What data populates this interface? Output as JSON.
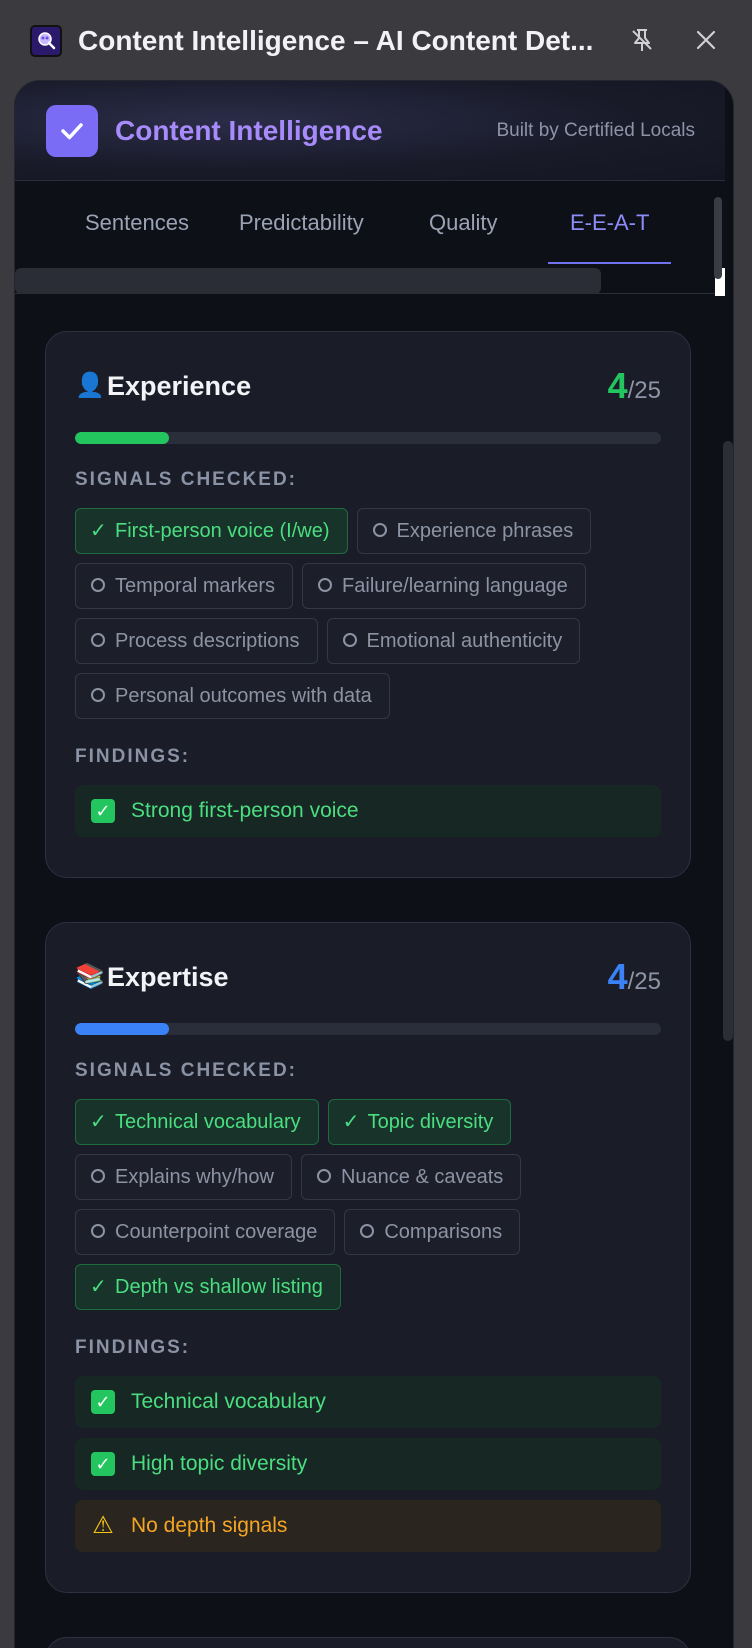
{
  "window": {
    "title": "Content Intelligence – AI Content Det...",
    "app_icon": "magnifier-brain-icon"
  },
  "header": {
    "brand": "Content Intelligence",
    "byline": "Built by Certified Locals"
  },
  "tabs": [
    {
      "label": "Sentences",
      "active": false
    },
    {
      "label": "Predictability",
      "active": false
    },
    {
      "label": "Quality",
      "active": false
    },
    {
      "label": "E-E-A-T",
      "active": true
    }
  ],
  "labels": {
    "signals": "SIGNALS CHECKED:",
    "findings": "FINDINGS:",
    "score_denominator": "/25"
  },
  "colors": {
    "accent": "#7b6cf6",
    "positive": "#22c55e",
    "expertise": "#3b82f6",
    "warning": "#f5a524"
  },
  "cards": {
    "experience": {
      "emoji": "👤",
      "title": "Experience",
      "score": "4",
      "score_fraction": 0.16,
      "signals": [
        {
          "label": "First-person voice (I/we)",
          "checked": true
        },
        {
          "label": "Experience phrases",
          "checked": false
        },
        {
          "label": "Temporal markers",
          "checked": false
        },
        {
          "label": "Failure/learning language",
          "checked": false
        },
        {
          "label": "Process descriptions",
          "checked": false
        },
        {
          "label": "Emotional authenticity",
          "checked": false
        },
        {
          "label": "Personal outcomes with data",
          "checked": false
        }
      ],
      "findings": [
        {
          "text": "Strong first-person voice",
          "type": "good"
        }
      ]
    },
    "expertise": {
      "emoji": "📚",
      "title": "Expertise",
      "score": "4",
      "score_fraction": 0.16,
      "signals": [
        {
          "label": "Technical vocabulary",
          "checked": true
        },
        {
          "label": "Topic diversity",
          "checked": true
        },
        {
          "label": "Explains why/how",
          "checked": false
        },
        {
          "label": "Nuance & caveats",
          "checked": false
        },
        {
          "label": "Counterpoint coverage",
          "checked": false
        },
        {
          "label": "Comparisons",
          "checked": false
        },
        {
          "label": "Depth vs shallow listing",
          "checked": true
        }
      ],
      "findings": [
        {
          "text": "Technical vocabulary",
          "type": "good"
        },
        {
          "text": "High topic diversity",
          "type": "good"
        },
        {
          "text": "No depth signals",
          "type": "warn"
        }
      ]
    }
  }
}
